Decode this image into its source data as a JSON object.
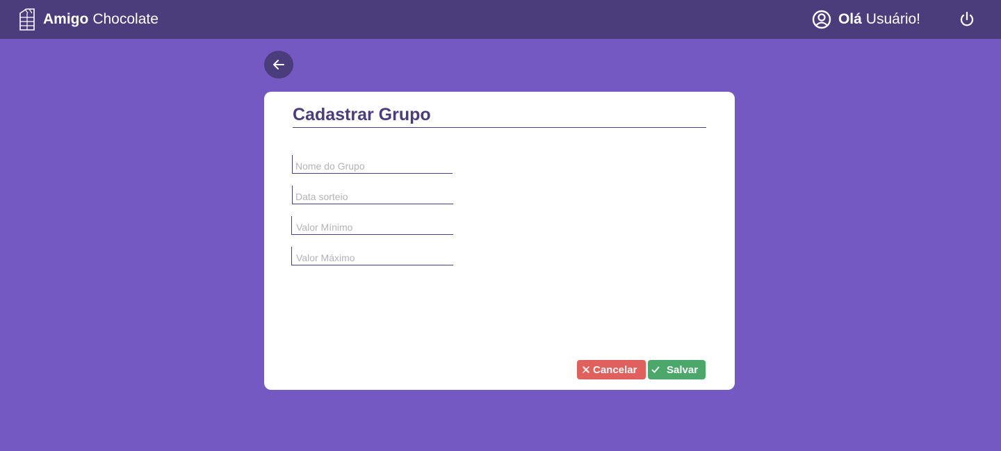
{
  "header": {
    "brand_bold": "Amigo",
    "brand_light": "Chocolate",
    "greeting_bold": "Olá",
    "greeting_name": "Usuário!",
    "logo_icon": "chocolate-bar-icon",
    "user_icon": "user-circle-icon",
    "power_icon": "power-icon"
  },
  "back": {
    "icon": "arrow-left-icon"
  },
  "form": {
    "title": "Cadastrar Grupo",
    "fields": [
      {
        "placeholder": "Nome do Grupo",
        "value": ""
      },
      {
        "placeholder": "Data sorteio",
        "value": ""
      },
      {
        "placeholder": "Valor Mínimo",
        "value": ""
      },
      {
        "placeholder": "Valor Máximo",
        "value": ""
      }
    ],
    "cancel_label": "Cancelar",
    "save_label": "Salvar"
  },
  "colors": {
    "background": "#7359c1",
    "header": "#4b3c7c",
    "accent": "#4b3c7c",
    "cancel": "#e0605d",
    "save": "#4ba86a"
  }
}
